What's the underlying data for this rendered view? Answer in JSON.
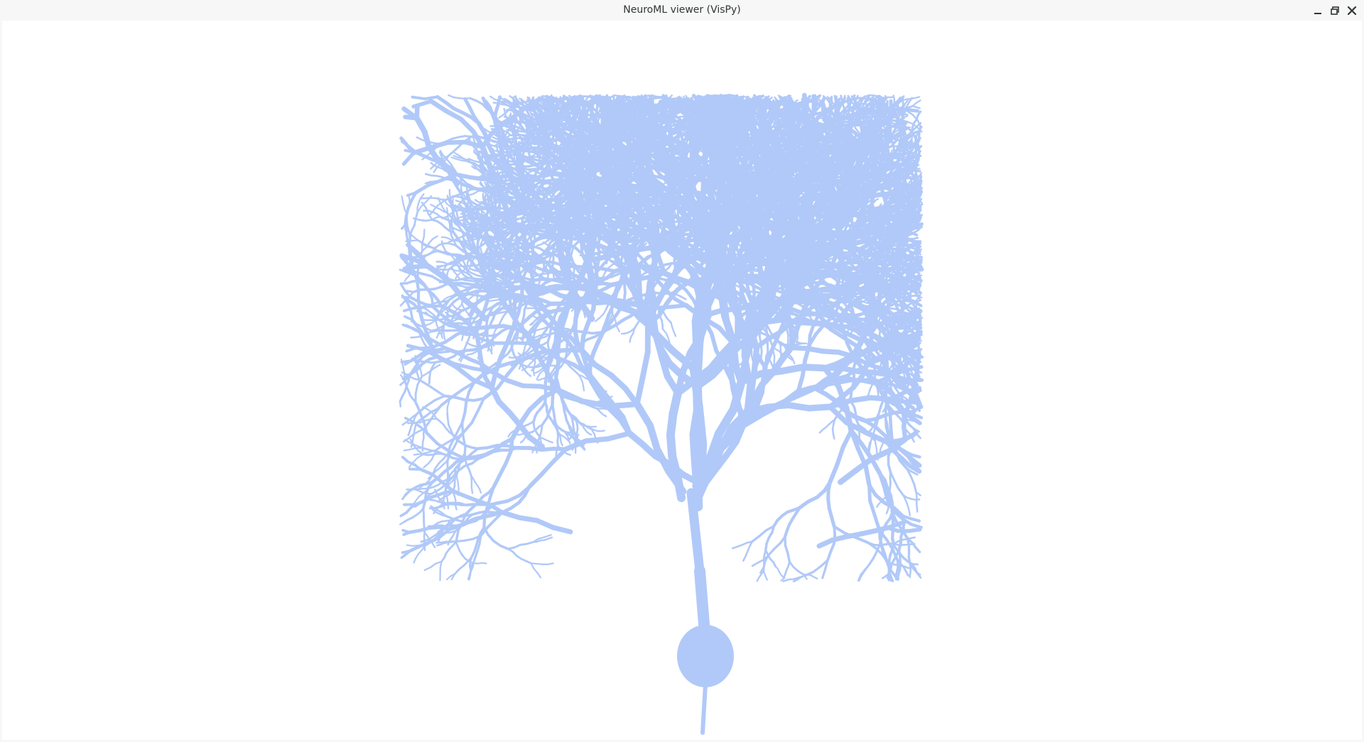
{
  "window": {
    "title": "NeuroML viewer (VisPy)",
    "controls": [
      {
        "name": "minimize-icon"
      },
      {
        "name": "restore-icon"
      },
      {
        "name": "close-icon"
      }
    ]
  },
  "scene": {
    "cell_color": "#b1c9f8",
    "background_color": "#ffffff",
    "icon": "neuron-morphology"
  }
}
